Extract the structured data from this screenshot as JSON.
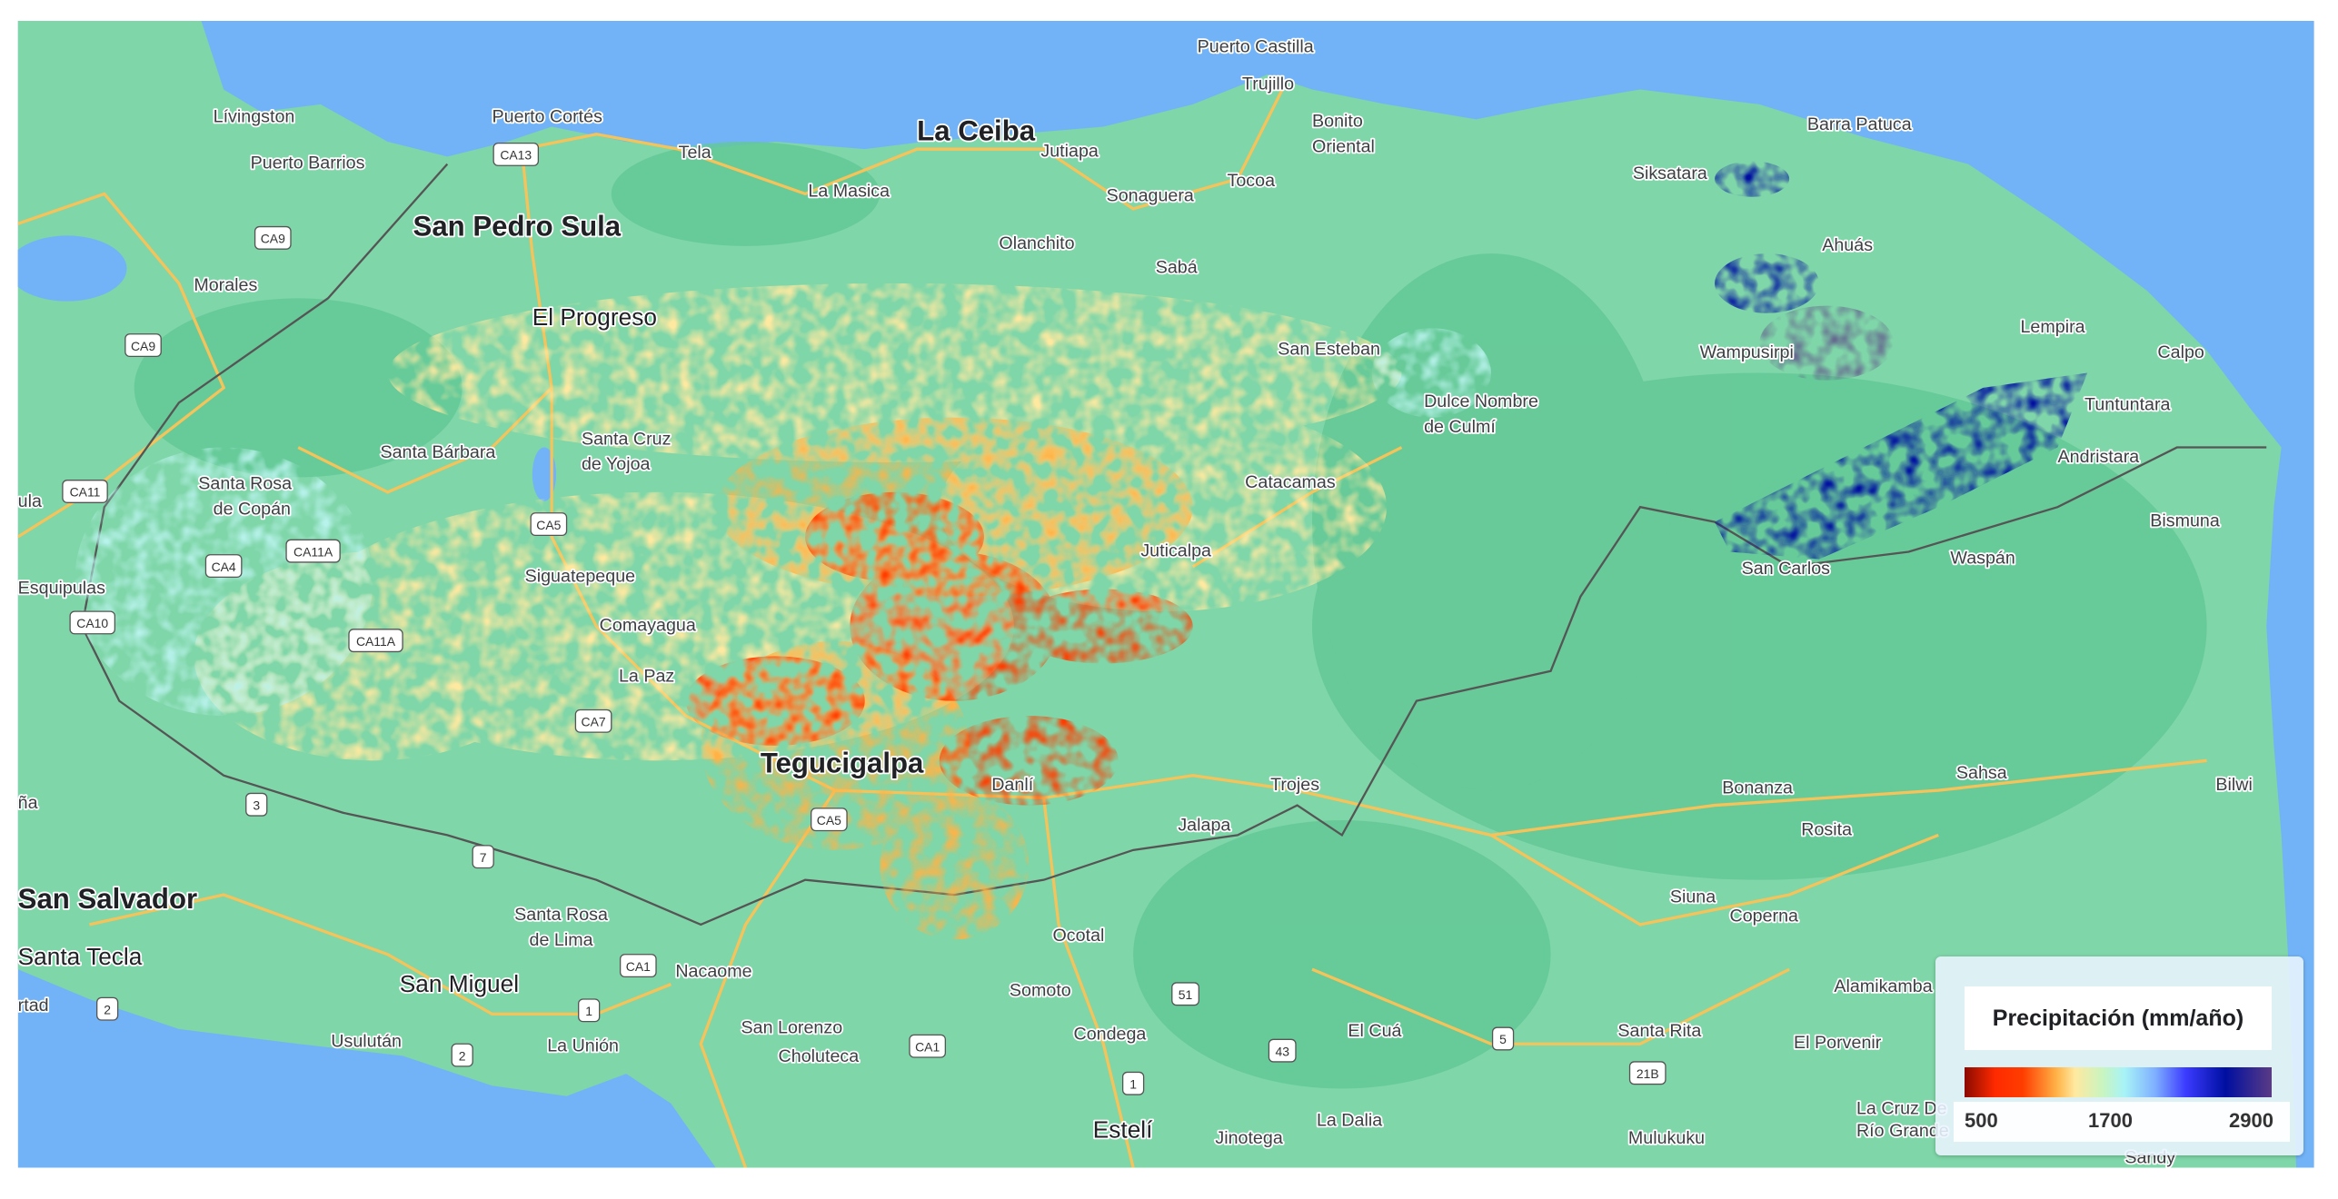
{
  "map": {
    "colors": {
      "ocean": "#72b3f7",
      "land": "#7fd6a8",
      "land_dark": "#62c895",
      "road": "#f6c35a",
      "border": "#555555"
    },
    "labels": [
      {
        "text": "Lívingston",
        "size": "small"
      },
      {
        "text": "Puerto Cortés",
        "size": "small"
      },
      {
        "text": "Puerto Barrios",
        "size": "small"
      },
      {
        "text": "Tela",
        "size": "small"
      },
      {
        "text": "La Ceiba",
        "size": "big"
      },
      {
        "text": "Jutiapa",
        "size": "small"
      },
      {
        "text": "La Masica",
        "size": "small"
      },
      {
        "text": "Sonaguera",
        "size": "small"
      },
      {
        "text": "Tocoa",
        "size": "small"
      },
      {
        "text": "Puerto Castilla",
        "size": "small"
      },
      {
        "text": "Trujillo",
        "size": "small"
      },
      {
        "text": "Bonito",
        "size": "small"
      },
      {
        "text": "Oriental",
        "size": "small"
      },
      {
        "text": "Barra Patuca",
        "size": "small"
      },
      {
        "text": "Siksatara",
        "size": "small"
      },
      {
        "text": "Ahuás",
        "size": "small"
      },
      {
        "text": "Lempira",
        "size": "small"
      },
      {
        "text": "Calpo",
        "size": "small"
      },
      {
        "text": "Wampusirpi",
        "size": "small"
      },
      {
        "text": "Tuntuntara",
        "size": "small"
      },
      {
        "text": "Andristara",
        "size": "small"
      },
      {
        "text": "Bismuna",
        "size": "small"
      },
      {
        "text": "San Carlos",
        "size": "small"
      },
      {
        "text": "Waspán",
        "size": "small"
      },
      {
        "text": "San Pedro Sula",
        "size": "big"
      },
      {
        "text": "Morales",
        "size": "small"
      },
      {
        "text": "El Progreso",
        "size": "mid"
      },
      {
        "text": "Olanchito",
        "size": "small"
      },
      {
        "text": "Sabá",
        "size": "small"
      },
      {
        "text": "San Esteban",
        "size": "small"
      },
      {
        "text": "Dulce Nombre",
        "size": "small"
      },
      {
        "text": "de Culmí",
        "size": "small"
      },
      {
        "text": "Santa Bárbara",
        "size": "small"
      },
      {
        "text": "Santa Cruz",
        "size": "small"
      },
      {
        "text": "de Yojoa",
        "size": "small"
      },
      {
        "text": "Santa Rosa",
        "size": "small"
      },
      {
        "text": "de Copán",
        "size": "small"
      },
      {
        "text": "Catacamas",
        "size": "small"
      },
      {
        "text": "Juticalpa",
        "size": "small"
      },
      {
        "text": "Siguatepeque",
        "size": "small"
      },
      {
        "text": "Comayagua",
        "size": "small"
      },
      {
        "text": "La Paz",
        "size": "small"
      },
      {
        "text": "Esquipulas",
        "size": "small"
      },
      {
        "text": "Tegucigalpa",
        "size": "big"
      },
      {
        "text": "Danlí",
        "size": "small"
      },
      {
        "text": "Trojes",
        "size": "small"
      },
      {
        "text": "Jalapa",
        "size": "small"
      },
      {
        "text": "Bonanza",
        "size": "small"
      },
      {
        "text": "Sahsa",
        "size": "small"
      },
      {
        "text": "Bilwi",
        "size": "small"
      },
      {
        "text": "Rosita",
        "size": "small"
      },
      {
        "text": "Siuna",
        "size": "small"
      },
      {
        "text": "Coperna",
        "size": "small"
      },
      {
        "text": "San Salvador",
        "size": "big"
      },
      {
        "text": "Santa Tecla",
        "size": "mid"
      },
      {
        "text": "Santa Rosa",
        "size": "small"
      },
      {
        "text": "de Lima",
        "size": "small"
      },
      {
        "text": "San Miguel",
        "size": "mid"
      },
      {
        "text": "Nacaome",
        "size": "small"
      },
      {
        "text": "Ocotal",
        "size": "small"
      },
      {
        "text": "Somoto",
        "size": "small"
      },
      {
        "text": "San Lorenzo",
        "size": "small"
      },
      {
        "text": "Choluteca",
        "size": "small"
      },
      {
        "text": "Condega",
        "size": "small"
      },
      {
        "text": "Usulután",
        "size": "small"
      },
      {
        "text": "La Unión",
        "size": "small"
      },
      {
        "text": "Estelí",
        "size": "mid"
      },
      {
        "text": "Jinotega",
        "size": "small"
      },
      {
        "text": "La Dalia",
        "size": "small"
      },
      {
        "text": "El Cuá",
        "size": "small"
      },
      {
        "text": "Santa Rita",
        "size": "small"
      },
      {
        "text": "El Porvenir",
        "size": "small"
      },
      {
        "text": "Alamikamba",
        "size": "small"
      },
      {
        "text": "Mulukuku",
        "size": "small"
      },
      {
        "text": "La Cruz De",
        "size": "small"
      },
      {
        "text": "Río Grande",
        "size": "small"
      },
      {
        "text": "Sandy",
        "size": "small"
      },
      {
        "text": "rtad",
        "size": "small"
      },
      {
        "text": "ña",
        "size": "small"
      },
      {
        "text": "ula",
        "size": "small"
      }
    ],
    "shields": [
      "CA13",
      "CA9",
      "CA9",
      "CA11",
      "CA4",
      "CA11A",
      "CA10",
      "CA5",
      "CA11A",
      "CA7",
      "3",
      "7",
      "CA5",
      "2",
      "2",
      "1",
      "CA1",
      "CA1",
      "1",
      "51",
      "43",
      "5",
      "21B"
    ]
  },
  "legend": {
    "title": "Precipitación (mm/año)",
    "min": "500",
    "mid": "1700",
    "max": "2900",
    "colors": [
      "#8b0a00",
      "#ff2a00",
      "#ffb347",
      "#ffe9a0",
      "#a8f3f7",
      "#3b3bff",
      "#000fa0",
      "#5a3b85"
    ]
  }
}
